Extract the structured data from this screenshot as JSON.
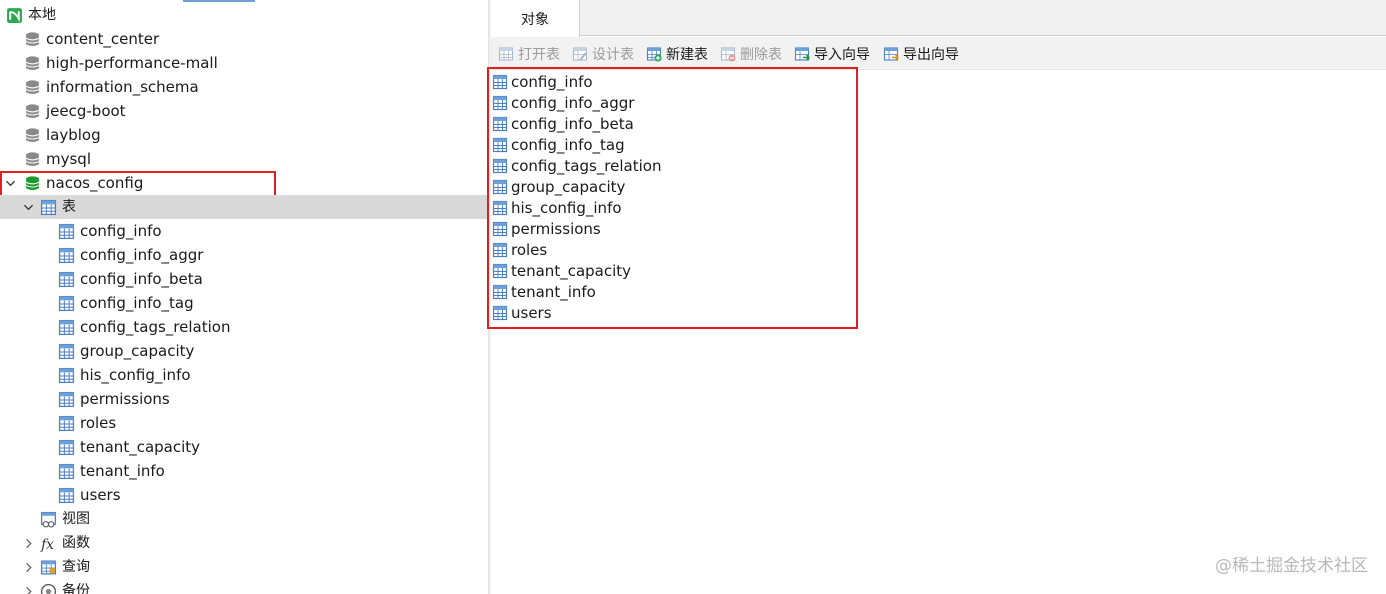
{
  "connection": {
    "name": "本地",
    "icon": "navicat-connection-icon"
  },
  "databases": [
    {
      "name": "content_center",
      "icon": "database-icon"
    },
    {
      "name": "high-performance-mall",
      "icon": "database-icon"
    },
    {
      "name": "information_schema",
      "icon": "database-icon"
    },
    {
      "name": "jeecg-boot",
      "icon": "database-icon"
    },
    {
      "name": "layblog",
      "icon": "database-icon"
    },
    {
      "name": "mysql",
      "icon": "database-icon"
    },
    {
      "name": "nacos_config",
      "icon": "database-open-icon",
      "expanded": true
    }
  ],
  "groups": {
    "tables": {
      "label": "表",
      "expanded": true
    },
    "views": {
      "label": "视图"
    },
    "functions": {
      "label": "函数"
    },
    "queries": {
      "label": "查询"
    },
    "backups": {
      "label": "备份"
    }
  },
  "tables": [
    "config_info",
    "config_info_aggr",
    "config_info_beta",
    "config_info_tag",
    "config_tags_relation",
    "group_capacity",
    "his_config_info",
    "permissions",
    "roles",
    "tenant_capacity",
    "tenant_info",
    "users"
  ],
  "tab": {
    "label": "对象"
  },
  "toolbar": {
    "open_table": "打开表",
    "design_table": "设计表",
    "new_table": "新建表",
    "delete_table": "删除表",
    "import_wizard": "导入向导",
    "export_wizard": "导出向导"
  },
  "watermark": "@稀土掘金技术社区",
  "colors": {
    "highlight_box": "#e02020",
    "selected_row": "#d9d9d9",
    "db_active": "#1c9a2c"
  }
}
